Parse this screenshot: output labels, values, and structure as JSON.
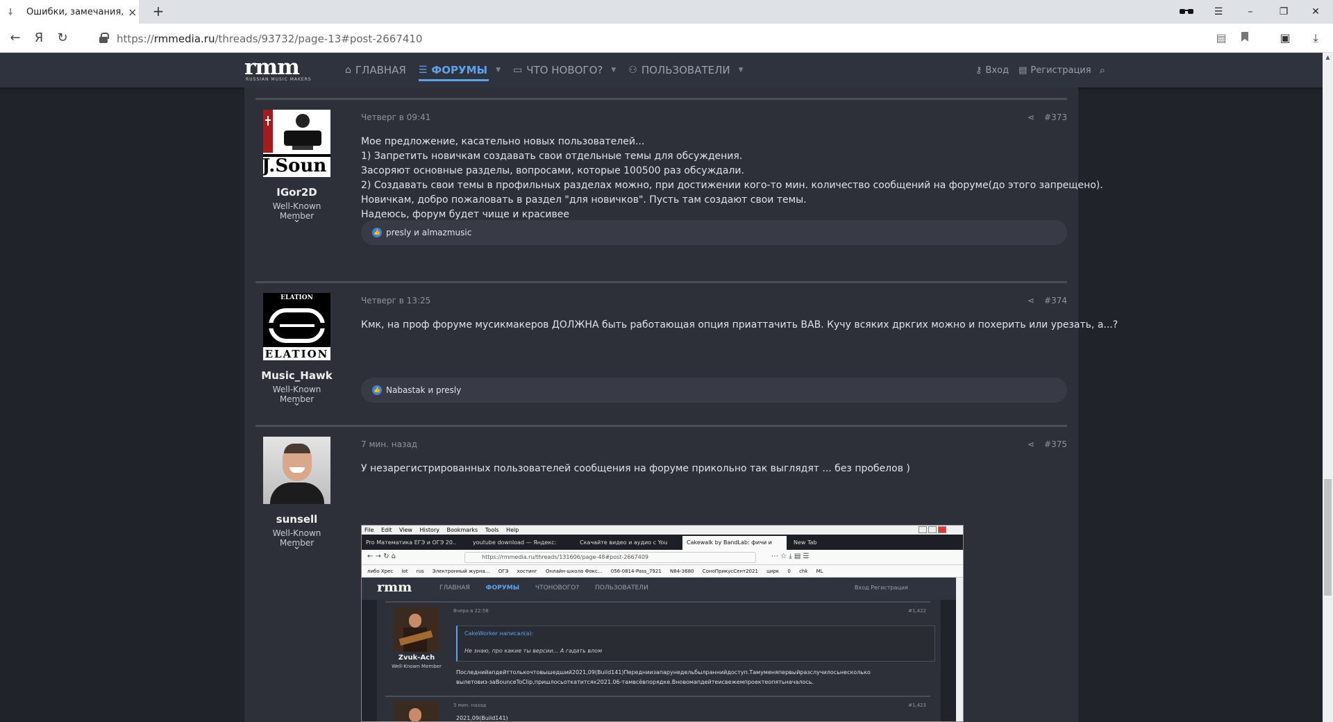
{
  "browser": {
    "tab_title": "Ошибки, замечания, пр",
    "tab_favicon": "rmm-favicon",
    "new_tab": "+",
    "url_prefix": "https://",
    "url_host": "rmmedia.ru",
    "url_path": "/threads/93732/page-13#post-2667410",
    "back_icon": "←",
    "yandex_icon": "Я",
    "reload_icon": "↻"
  },
  "site": {
    "logo": "rmm",
    "logo_sub": "RUSSIAN MUSIC MAKERS",
    "nav": [
      {
        "label": "ГЛАВНАЯ",
        "icon": "home-icon"
      },
      {
        "label": "ФОРУМЫ",
        "icon": "forums-icon"
      },
      {
        "label": "ЧТО НОВОГО?",
        "icon": "whats-new-icon"
      },
      {
        "label": "ПОЛЬЗОВАТЕЛИ",
        "icon": "users-icon"
      }
    ],
    "login": "Вход",
    "register": "Регистрация"
  },
  "posts": [
    {
      "username": "IGor2D",
      "user_title": "Well-Known Member",
      "avatar_text": "J.Soun",
      "date": "Четверг в 09:41",
      "number": "#373",
      "lines": [
        "Мое предложение, касательно новых пользователей...",
        "1) Запретить новичкам создавать свои отдельные темы для обсуждения.",
        "Засоряют основные разделы, вопросами, которые 100500 раз обсуждали.",
        "2) Создавать свои темы в профильных разделах можно, при достижении кого-то мин. количество сообщений на форуме(до этого запрещено).",
        "Новичкам, добро пожаловать в раздел \"для новичков\". Пусть там создают свои темы.",
        "Надеюсь, форум будет чище и красивее"
      ],
      "likes": "presly и almazmusic"
    },
    {
      "username": "Music_Hawk",
      "user_title": "Well-Known Member",
      "avatar_text_top": "ELATION",
      "avatar_text_bottom": "ELATION",
      "date": "Четверг в 13:25",
      "number": "#374",
      "lines": [
        "Кмк, на проф форуме мусикмакеров ДОЛЖНА быть работающая опция приаттачить ВАВ. Кучу всяких дркгих можно и похерить или урезать, а...?"
      ],
      "likes": "Nabastak и presly"
    },
    {
      "username": "sunsell",
      "user_title": "Well-Known Member",
      "date": "7 мин. назад",
      "number": "#375",
      "lines": [
        "У незарегистрированных пользователей сообщения на форуме прикольно так выглядят ... без пробелов )"
      ]
    }
  ],
  "embedded": {
    "menu": [
      "File",
      "Edit",
      "View",
      "History",
      "Bookmarks",
      "Tools",
      "Help"
    ],
    "tabs": [
      "Pro Математика ЕГЭ и ОГЭ 20..",
      "youtube download — Яндекс:",
      "Скачайте видео и аудио с You",
      "Cakewalk by BandLab: фичи и",
      "New Tab"
    ],
    "url": "https://rmmedia.ru/threads/131606/page-48#post-2667409",
    "bookmarks": [
      "либо Хрес",
      "lot",
      "rus",
      "Электронный журна...",
      "ОГЭ",
      "хостинг",
      "Онлайн-школа Фокс...",
      "056-0814-Pass_7921",
      "N84-3680",
      "СоноПрикусСент2021",
      "цирк",
      "0",
      "chk",
      "ML"
    ],
    "logo": "rmm",
    "nav": [
      "ГЛАВНАЯ",
      "ФОРУМЫ",
      "ЧТОНОВОГО?",
      "ПОЛЬЗОВАТЕЛИ"
    ],
    "auth": "Вход   Регистрация",
    "post1": {
      "date": "Вчера в 22:58",
      "number": "#1,422",
      "username": "Zvuk-Ach",
      "user_title": "Well-Known Member",
      "quote_author": "CakeWorker написал(а):",
      "quote_text": "Не знаю, про какие ты версии... А гадать влом",
      "text1": "Последнийапдейттолькочтовышедший2021,09(Build141)Передниизапарунедельбылраннийдоступ.Тамуменяпервыйразслучилосьнесколько",
      "text2": "вылетовиз-заBounceToClip,пришлосьоткатитсяк2021.06-тамвсёвпорядке.Вновомапдейтеисвежемпроектеопятьначалось."
    },
    "post2": {
      "date": "5 мин. назад",
      "number": "#1,423",
      "text1": "2021,09(Build141)"
    }
  },
  "colors": {
    "accent": "#5ea2ee",
    "header_bg": "#2f333d",
    "content_bg": "#2e3039",
    "page_bg": "#20232a"
  }
}
